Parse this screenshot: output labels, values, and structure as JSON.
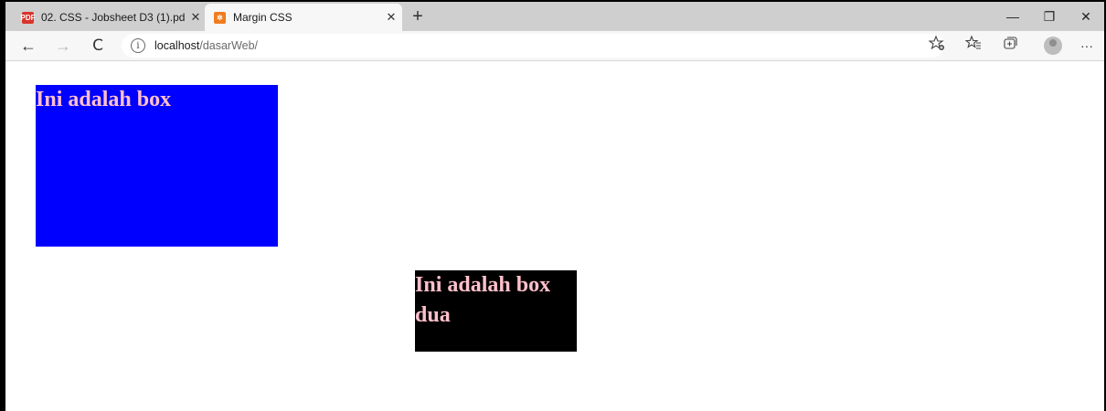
{
  "browser": {
    "tabs": [
      {
        "title": "02. CSS - Jobsheet D3 (1).pdf",
        "icon": "pdf-icon",
        "active": false
      },
      {
        "title": "Margin CSS",
        "icon": "xampp-icon",
        "active": true
      }
    ],
    "tab_close_glyph": "✕",
    "new_tab_glyph": "+",
    "window_controls": {
      "minimize": "—",
      "restore": "❐",
      "close": "✕"
    },
    "nav": {
      "back": "←",
      "forward": "→",
      "reload": "C"
    },
    "address": {
      "host": "localhost",
      "path": "/dasarWeb/"
    },
    "toolbar_icons": [
      "add-favorite-icon",
      "favorites-icon",
      "collections-icon",
      "profile-avatar",
      "more-icon"
    ],
    "more_glyph": "···"
  },
  "page": {
    "box1": {
      "text": "Ini adalah box",
      "background": "#0000ff",
      "color": "pink"
    },
    "box2": {
      "text": "Ini adalah box dua",
      "background": "#000000",
      "color": "pink"
    }
  }
}
